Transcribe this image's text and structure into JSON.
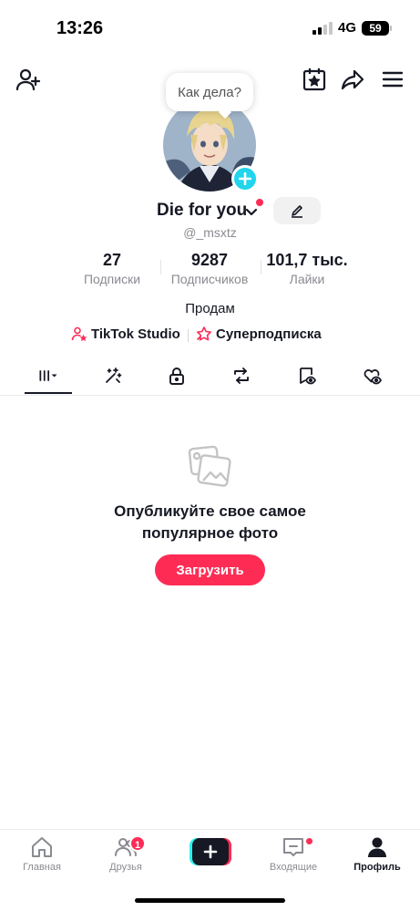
{
  "status_bar": {
    "time": "13:26",
    "network": "4G",
    "battery": "59"
  },
  "header": {
    "icons": [
      "add-friend-icon",
      "calendar-star-icon",
      "share-icon",
      "menu-icon"
    ]
  },
  "profile": {
    "bubble_text": "Как дела?",
    "display_name": "Die for you",
    "username": "@_msxtz",
    "stats": [
      {
        "value": "27",
        "label": "Подписки"
      },
      {
        "value": "9287",
        "label": "Подписчиков"
      },
      {
        "value": "101,7 тыс.",
        "label": "Лайки"
      }
    ],
    "bio": "Продам",
    "links": [
      {
        "label": "TikTok Studio",
        "icon": "studio-icon"
      },
      {
        "label": "Суперподписка",
        "icon": "super-subscription-icon"
      }
    ]
  },
  "tabs": [
    "videos-grid",
    "reposts-sparkle",
    "private-lock",
    "repost",
    "saved-bookmark",
    "liked-heart"
  ],
  "empty_state": {
    "title_line1": "Опубликуйте свое самое",
    "title_line2": "популярное фото",
    "button": "Загрузить"
  },
  "bottom_nav": {
    "items": [
      {
        "label": "Главная"
      },
      {
        "label": "Друзья",
        "badge": "1"
      },
      {
        "label": "Входящие"
      },
      {
        "label": "Профиль"
      }
    ]
  },
  "colors": {
    "accent": "#fe2c55",
    "cyan": "#25f4ee",
    "plus_badge": "#20d5ec",
    "text": "#161823",
    "muted": "#8a8b91"
  }
}
